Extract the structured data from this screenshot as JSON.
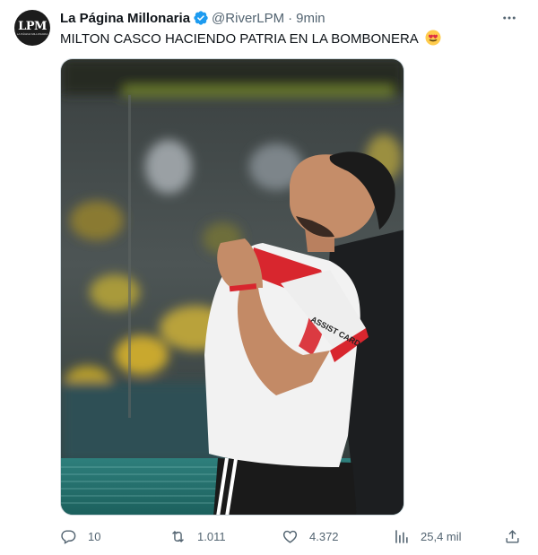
{
  "tweet": {
    "author": {
      "display_name": "La Página Millonaria",
      "handle": "@RiverLPM",
      "verified": true,
      "avatar_text": "LPM",
      "avatar_subtext": "LA PÁGINA MILLONARIA"
    },
    "separator": "·",
    "timestamp": "9min",
    "text": "MILTON CASCO HACIENDO PATRIA EN LA BOMBONERA",
    "emoji": "heart-eyes-emoji",
    "media": {
      "type": "photo",
      "jersey_sponsor": "ASSIST CARD"
    },
    "actions": {
      "reply_count": "10",
      "retweet_count": "1.011",
      "like_count": "4.372",
      "views_count": "25,4 mil"
    }
  },
  "icons": {
    "verified": "verified-badge-icon",
    "more": "more-options-icon",
    "reply": "reply-icon",
    "retweet": "retweet-icon",
    "like": "heart-icon",
    "views": "views-chart-icon",
    "share": "share-icon"
  },
  "colors": {
    "verified_blue": "#1d9bf0",
    "secondary_text": "#536471",
    "primary_text": "#0f1419",
    "border": "#cfd9de"
  }
}
